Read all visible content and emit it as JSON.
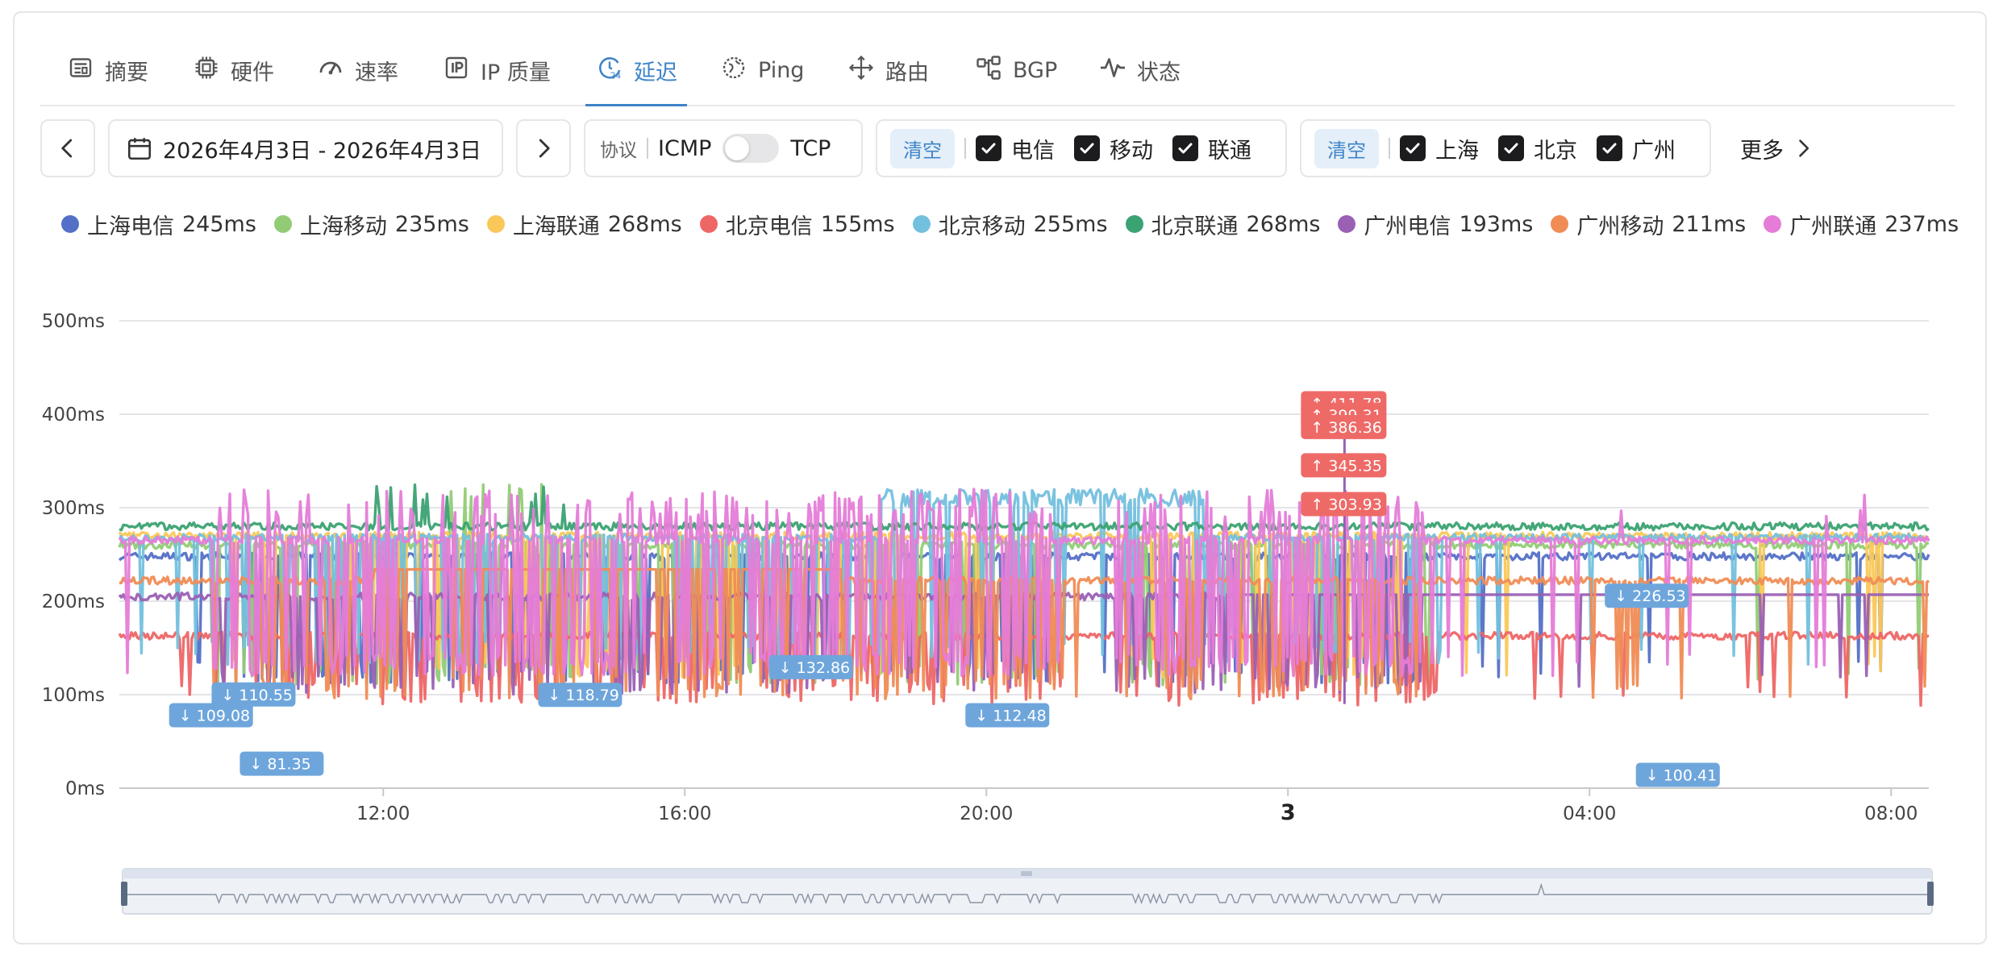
{
  "tabs": [
    {
      "label": "摘要",
      "icon": "summary-icon",
      "active": false
    },
    {
      "label": "硬件",
      "icon": "chip-icon",
      "active": false
    },
    {
      "label": "速率",
      "icon": "speedometer-icon",
      "active": false
    },
    {
      "label": "IP 质量",
      "icon": "ip-icon",
      "active": false
    },
    {
      "label": "延迟",
      "icon": "latency-clock-icon",
      "active": true
    },
    {
      "label": "Ping",
      "icon": "globe-icon",
      "active": false
    },
    {
      "label": "路由",
      "icon": "route-icon",
      "active": false
    },
    {
      "label": "BGP",
      "icon": "bgp-icon",
      "active": false
    },
    {
      "label": "状态",
      "icon": "pulse-icon",
      "active": false
    }
  ],
  "toolbar": {
    "date_range": "2026年4月3日 - 2026年4月3日",
    "protocol_label": "协议",
    "protocol_left": "ICMP",
    "protocol_right": "TCP",
    "isp_clear": "清空",
    "isps": [
      "电信",
      "移动",
      "联通"
    ],
    "city_clear": "清空",
    "cities": [
      "上海",
      "北京",
      "广州"
    ],
    "more": "更多"
  },
  "colors": {
    "accent": "#3f84c8",
    "up_badge": "#ee6a67",
    "down_badge": "#6ea6dc"
  },
  "chart_data": {
    "type": "line",
    "ylabel_unit": "ms",
    "ylim": [
      0,
      500
    ],
    "yticks": [
      "0ms",
      "100ms",
      "200ms",
      "300ms",
      "400ms",
      "500ms"
    ],
    "xticks": [
      "12:00",
      "16:00",
      "20:00",
      "3",
      "04:00",
      "08:00"
    ],
    "x_range": [
      "2026-04-02 08:30",
      "2026-04-03 08:30"
    ],
    "grid": true,
    "series": [
      {
        "name": "上海电信",
        "latest": "245ms",
        "color": "#5470c6",
        "base": 248,
        "low": 112
      },
      {
        "name": "上海移动",
        "latest": "235ms",
        "color": "#91cc75",
        "base": 260,
        "low": 110
      },
      {
        "name": "上海联通",
        "latest": "268ms",
        "color": "#fac858",
        "base": 270,
        "low": 118
      },
      {
        "name": "北京电信",
        "latest": "155ms",
        "color": "#ee6666",
        "base": 163,
        "low": 88
      },
      {
        "name": "北京移动",
        "latest": "255ms",
        "color": "#73c0de",
        "base": 268,
        "low": 132
      },
      {
        "name": "北京联通",
        "latest": "268ms",
        "color": "#3ba272",
        "base": 280,
        "low": 250
      },
      {
        "name": "广州电信",
        "latest": "193ms",
        "color": "#9a60b4",
        "base": 205,
        "low": 100
      },
      {
        "name": "广州移动",
        "latest": "211ms",
        "color": "#f08c55",
        "base": 222,
        "low": 95
      },
      {
        "name": "广州联通",
        "latest": "237ms",
        "color": "#e57cd8",
        "base": 265,
        "low": 120
      }
    ],
    "max_annotations": [
      {
        "label": "↑ 411.78",
        "value": 411.78,
        "time": "2026-04-03 00:45"
      },
      {
        "label": "↑ 399.31",
        "value": 399.31,
        "time": "2026-04-03 00:45"
      },
      {
        "label": "↑ 386.36",
        "value": 386.36,
        "time": "2026-04-03 00:45"
      },
      {
        "label": "↑ 345.35",
        "value": 345.35,
        "time": "2026-04-03 00:45"
      },
      {
        "label": "↑ 303.93",
        "value": 303.93,
        "time": "2026-04-03 00:45"
      }
    ],
    "min_annotations": [
      {
        "label": "↓ 109.08",
        "value": 109.08,
        "time": "2026-04-02 09:25"
      },
      {
        "label": "↓ 110.55",
        "value": 110.55,
        "time": "2026-04-02 09:55"
      },
      {
        "label": "↓ 81.35",
        "value": 81.35,
        "time": "2026-04-02 10:20"
      },
      {
        "label": "↓ 118.79",
        "value": 118.79,
        "time": "2026-04-02 14:20"
      },
      {
        "label": "↓ 132.86",
        "value": 132.86,
        "time": "2026-04-02 17:25"
      },
      {
        "label": "↓ 112.48",
        "value": 112.48,
        "time": "2026-04-02 20:00"
      },
      {
        "label": "↓ 226.53",
        "value": 226.53,
        "time": "2026-04-03 04:25"
      },
      {
        "label": "↓ 100.41",
        "value": 100.41,
        "time": "2026-04-03 05:00"
      }
    ]
  }
}
